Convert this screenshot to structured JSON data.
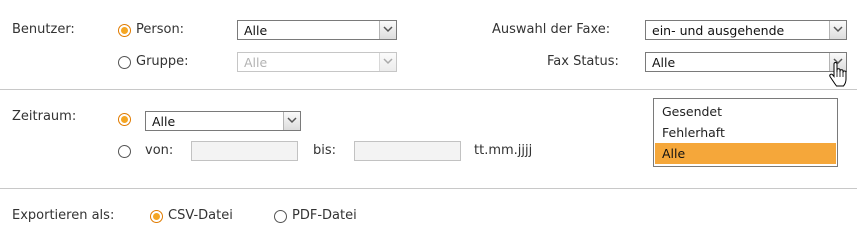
{
  "user_section": {
    "label": "Benutzer:",
    "person_radio": {
      "label": "Person:",
      "checked": true
    },
    "person_select": {
      "value": "Alle"
    },
    "group_radio": {
      "label": "Gruppe:",
      "checked": false
    },
    "group_select": {
      "value": "Alle",
      "disabled": true
    }
  },
  "fax_selection": {
    "label": "Auswahl der Faxe:",
    "value": "ein- und ausgehende"
  },
  "fax_status": {
    "label": "Fax Status:",
    "value": "Alle",
    "dropdown_open": true,
    "options": [
      {
        "label": "Gesendet",
        "selected": false
      },
      {
        "label": "Fehlerhaft",
        "selected": false
      },
      {
        "label": "Alle",
        "selected": true
      }
    ]
  },
  "period_section": {
    "label": "Zeitraum:",
    "all_radio_checked": true,
    "period_select": {
      "value": "Alle"
    },
    "range_radio": {
      "checked": false
    },
    "from_label": "von:",
    "from_value": "",
    "to_label": "bis:",
    "to_value": "",
    "date_format_hint": "tt.mm.jjjj"
  },
  "export_section": {
    "label": "Exportieren als:",
    "csv": {
      "label": "CSV-Datei",
      "checked": true
    },
    "pdf": {
      "label": "PDF-Datei",
      "checked": false
    }
  },
  "colors": {
    "accent": "#f5a623",
    "selected_option": "#f5a73a",
    "divider": "#c8c8c8"
  },
  "icons": [
    "chevron-down-icon",
    "hand-pointer-cursor-icon"
  ]
}
